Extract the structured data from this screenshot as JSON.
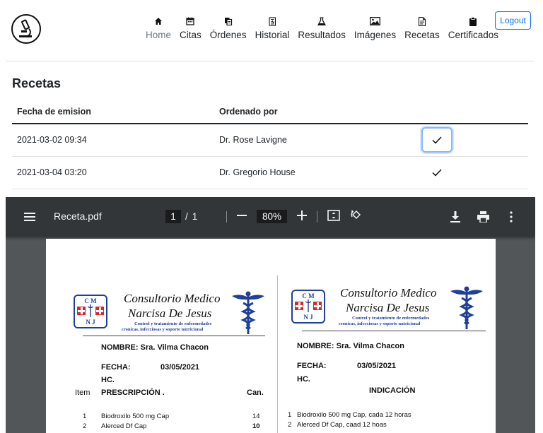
{
  "nav": {
    "items": [
      {
        "label": "Home",
        "icon": "house-icon"
      },
      {
        "label": "Citas",
        "icon": "calendar-icon"
      },
      {
        "label": "Órdenes",
        "icon": "files-icon"
      },
      {
        "label": "Historial",
        "icon": "journal-icon"
      },
      {
        "label": "Resultados",
        "icon": "flask-icon"
      },
      {
        "label": "Imágenes",
        "icon": "image-icon"
      },
      {
        "label": "Recetas",
        "icon": "file-text-icon"
      },
      {
        "label": "Certificados",
        "icon": "clipboard-icon"
      }
    ],
    "logout": "Logout"
  },
  "page": {
    "title": "Recetas",
    "columns": [
      "Fecha de emision",
      "Ordenado por"
    ],
    "rows": [
      {
        "date": "2021-03-02 09:34",
        "doctor": "Dr. Rose Lavigne"
      },
      {
        "date": "2021-03-04 03:20",
        "doctor": "Dr. Gregorio House"
      }
    ]
  },
  "viewer": {
    "filename": "Receta.pdf",
    "page_current": "1",
    "page_sep": "/",
    "page_total": "1",
    "zoom": "80%"
  },
  "doc": {
    "clinic_line1": "Consultorio Medico",
    "clinic_line2": "Narcisa De Jesus",
    "clinic_sub1": "Control y tratamiento de enfermedades",
    "clinic_sub2": "cronicas, infecciosas y soporte nutricional",
    "badge_top": "C M",
    "badge_bottom": "N J",
    "nombre": "NOMBRE: Sra. Vilma Chacon",
    "fecha_label": "FECHA:",
    "fecha_value": "03/05/2021",
    "hc": "HC.",
    "item": "Item",
    "prescripcion": "PRESCRIPCIÓN .",
    "can": "Can.",
    "indicacion": "INDICACIÓN",
    "left_items": [
      {
        "n": "1",
        "name": "Biodroxilo 500 mg Cap",
        "qty": "14"
      },
      {
        "n": "2",
        "name": "Alerced Df Cap",
        "qty": "10"
      }
    ],
    "right_items": [
      {
        "n": "1",
        "text": "Biodroxilo 500 mg Cap, cada 12 horas"
      },
      {
        "n": "2",
        "text": "Alerced Df Cap, caad 12 hoas"
      }
    ]
  }
}
